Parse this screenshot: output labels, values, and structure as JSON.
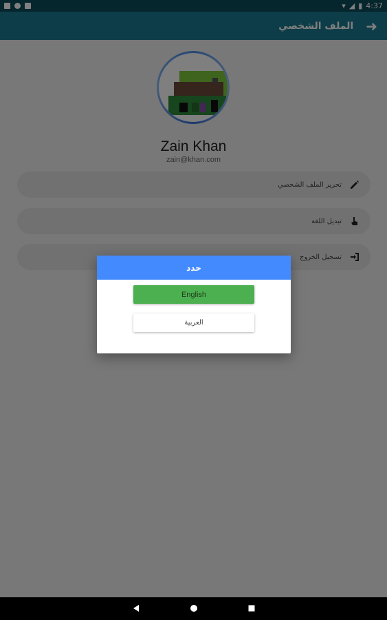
{
  "status_bar": {
    "time": "4:37"
  },
  "app_bar": {
    "title": "الملف الشخصي",
    "back_icon": "arrow-right-icon"
  },
  "profile": {
    "name": "Zain Khan",
    "email": "zain@khan.com"
  },
  "menu": [
    {
      "label": "تحرير الملف الشخصي",
      "icon": "pencil-icon"
    },
    {
      "label": "تبديل اللغة",
      "icon": "hand-pointer-icon"
    },
    {
      "label": "تسجيل الخروج",
      "icon": "logout-icon"
    }
  ],
  "dialog": {
    "title": "حدد",
    "english_label": "English",
    "arabic_label": "العربية"
  },
  "colors": {
    "status_bar": "#0d4d5d",
    "app_bar": "#1a7b90",
    "dialog_header": "#448aff",
    "english_button": "#4caf50"
  }
}
